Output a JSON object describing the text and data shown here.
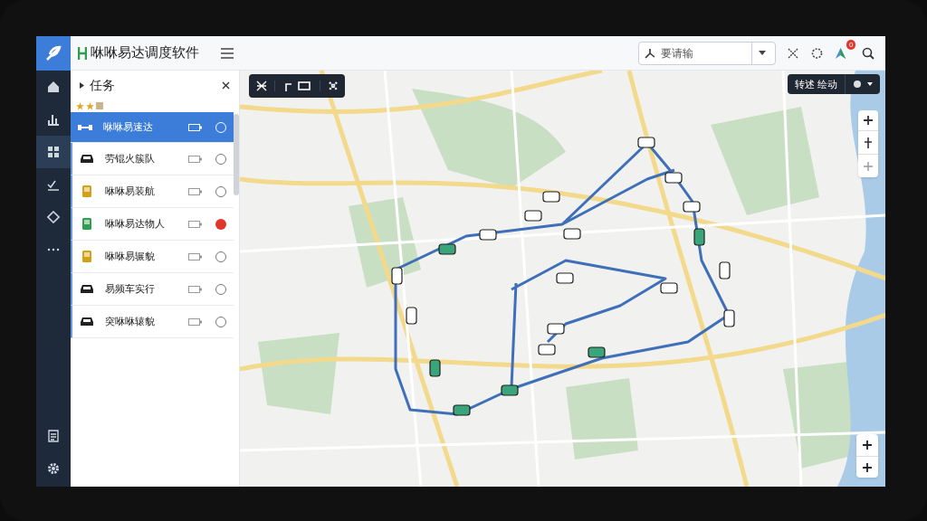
{
  "app": {
    "title": "咻咻易达调度软件"
  },
  "search": {
    "placeholder": "要请输"
  },
  "notifications": {
    "count": "0"
  },
  "panel": {
    "title": "任务"
  },
  "tasks": [
    {
      "name": "咻咻易速达",
      "kind": "shuttle",
      "selected": true,
      "alert": false
    },
    {
      "name": "劳锟火簇队",
      "kind": "car",
      "selected": false,
      "alert": false
    },
    {
      "name": "咻咻易装航",
      "kind": "bus",
      "color": "#d4a017",
      "selected": false,
      "alert": false
    },
    {
      "name": "咻咻易达物人",
      "kind": "bus",
      "color": "#2e9e4f",
      "selected": false,
      "alert": true
    },
    {
      "name": "咻咻易辗貌",
      "kind": "bus",
      "color": "#d4a017",
      "selected": false,
      "alert": false
    },
    {
      "name": "易频车实行",
      "kind": "car",
      "selected": false,
      "alert": false
    },
    {
      "name": "突咻咻辕貌",
      "kind": "car",
      "selected": false,
      "alert": false
    }
  ],
  "map_toolbar": {
    "action": "转述 绘动"
  }
}
